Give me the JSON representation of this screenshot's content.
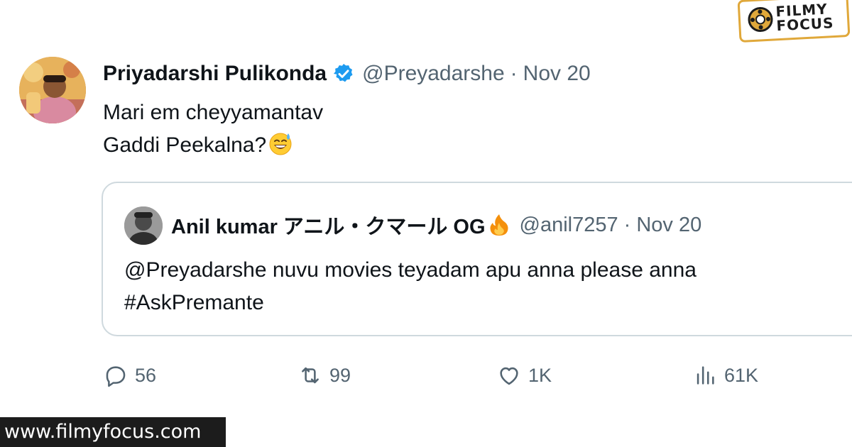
{
  "tweet": {
    "author": {
      "display_name": "Priyadarshi Pulikonda",
      "handle": "@Preyadarshe",
      "separator": "·",
      "date": "Nov 20"
    },
    "text_lines": [
      "Mari em cheyyamantav",
      "Gaddi Peekalna?"
    ],
    "quoted": {
      "display_name": "Anil kumar アニル・クマール OG",
      "handle": "@anil7257",
      "separator": "·",
      "date": "Nov 20",
      "text_lines": [
        "@Preyadarshe nuvu movies teyadam apu anna please anna",
        "#AskPremante"
      ]
    },
    "actions": {
      "replies": "56",
      "retweets": "99",
      "likes": "1K",
      "views": "61K"
    }
  },
  "watermark": {
    "url": "www.filmyfocus.com",
    "logo_line1": "FILMY",
    "logo_line2": "FOCUS"
  },
  "colors": {
    "verified_blue": "#1d9bf0",
    "secondary_text": "#536471",
    "border": "#cfd9de",
    "logo_accent": "#e0a83a"
  },
  "icons": [
    "verified-badge-icon",
    "sweat-smile-emoji-icon",
    "fire-emoji-icon",
    "reply-icon",
    "retweet-icon",
    "like-icon",
    "views-icon",
    "film-reel-logo-icon"
  ]
}
